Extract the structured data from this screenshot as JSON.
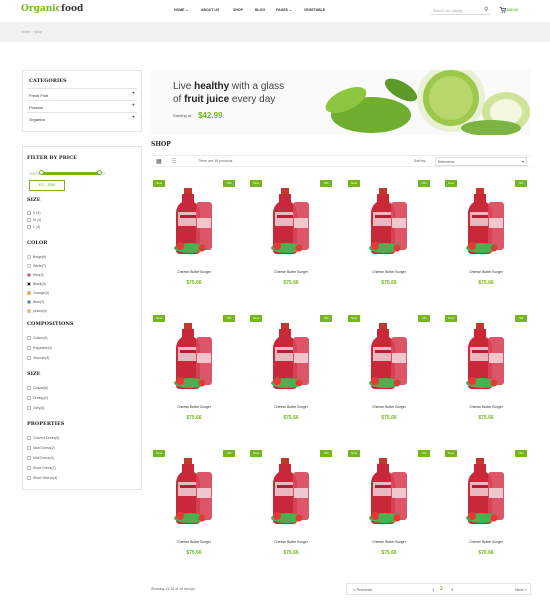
{
  "header": {
    "logo_green": "Organic",
    "logo_dark": "food",
    "nav": [
      "HOME",
      "ABOUT US",
      "SHOP",
      "BLOG",
      "PAGES",
      "VEGETABLE"
    ],
    "nav_home_caret": "⌄",
    "nav_pages_caret": "⌄",
    "search_placeholder": "Search our catalog",
    "cart_total": "$49.00"
  },
  "breadcrumb": "Home > shop",
  "categories": {
    "title": "CATEGORIES",
    "items": [
      "Fresh Fruit",
      "Flowers",
      "Organics"
    ]
  },
  "filter": {
    "title": "FILTER BY PRICE",
    "range_label": "$70 - $360",
    "range_min_fraction": 0.16,
    "range_max_fraction": 0.93,
    "size_title": "SIZE",
    "sizes": [
      "S (4)",
      "M (4)",
      "L (4)"
    ],
    "color_title": "COLOR",
    "colors": [
      {
        "label": "Beige(6)",
        "hex": "#f5f5dc"
      },
      {
        "label": "White(7)",
        "hex": "#ffffff"
      },
      {
        "label": "Red(4)",
        "hex": "#e53935"
      },
      {
        "label": "Black(4)",
        "hex": "#111111"
      },
      {
        "label": "Orange(4)",
        "hex": "#f39c12"
      },
      {
        "label": "Blue(4)",
        "hex": "#2c6ed5"
      },
      {
        "label": "yellow(4)",
        "hex": "#f1c40f"
      }
    ],
    "compositions_title": "COMPOSITIONS",
    "compositions": [
      "Cotton(6)",
      "Polyester(4)",
      "Viscose(4)"
    ],
    "size2_title": "SIZE",
    "sizes2": [
      "Casual(6)",
      "Dressy(2)",
      "Girly(4)"
    ],
    "properties_title": "PROPERTIES",
    "properties": [
      "Colorful Dress(6)",
      "Maxi Dress(2)",
      "Midi Dress(4)",
      "Short Dress(7)",
      "Short Sleeve(4)"
    ]
  },
  "banner": {
    "line1_a": "Live ",
    "line1_b": "healthy",
    "line1_c": " with a glass",
    "line2_a": "of ",
    "line2_b": "fruit juice",
    "line2_c": " every day",
    "starting_at": "Starting at",
    "price": "$42.99"
  },
  "shop": {
    "title": "SHOP",
    "results": "There are 16 products",
    "sort_label": "Sort by:",
    "sort_value": "Relevance"
  },
  "products": [
    {
      "name": "Cheese Butter Burger",
      "price": "$75.66",
      "new": "New",
      "off": "-5%"
    },
    {
      "name": "Cheese Butter Burger",
      "price": "$75.66",
      "new": "New",
      "off": "-5%"
    },
    {
      "name": "Cheese Butter Burger",
      "price": "$75.66",
      "new": "New",
      "off": "-5%"
    },
    {
      "name": "Cheese Butter Burger",
      "price": "$75.66",
      "new": "New",
      "off": "-5%"
    },
    {
      "name": "Cheese Butter Burger",
      "price": "$75.66",
      "new": "New",
      "off": "-5%"
    },
    {
      "name": "Cheese Butter Burger",
      "price": "$75.66",
      "new": "New",
      "off": "-5%"
    },
    {
      "name": "Cheese Butter Burger",
      "price": "$75.66",
      "new": "New",
      "off": "-5%"
    },
    {
      "name": "Cheese Butter Burger",
      "price": "$75.66",
      "new": "New",
      "off": "-5%"
    },
    {
      "name": "Cheese Butter Burger",
      "price": "$75.66",
      "new": "New",
      "off": "-5%"
    },
    {
      "name": "Cheese Butter Burger",
      "price": "$75.66",
      "new": "New",
      "off": "-5%"
    },
    {
      "name": "Cheese Butter Burger",
      "price": "$75.66",
      "new": "New",
      "off": "-5%"
    },
    {
      "name": "Cheese Butter Burger",
      "price": "$75.66",
      "new": "New",
      "off": "-5%"
    }
  ],
  "pager": {
    "showing": "Showing 13-16 of 16 item(s)",
    "previous": "< Previous",
    "pages": [
      "1",
      "2",
      "3"
    ],
    "current": "2",
    "next": "Next >"
  },
  "colors": {
    "accent": "#76b51b"
  }
}
